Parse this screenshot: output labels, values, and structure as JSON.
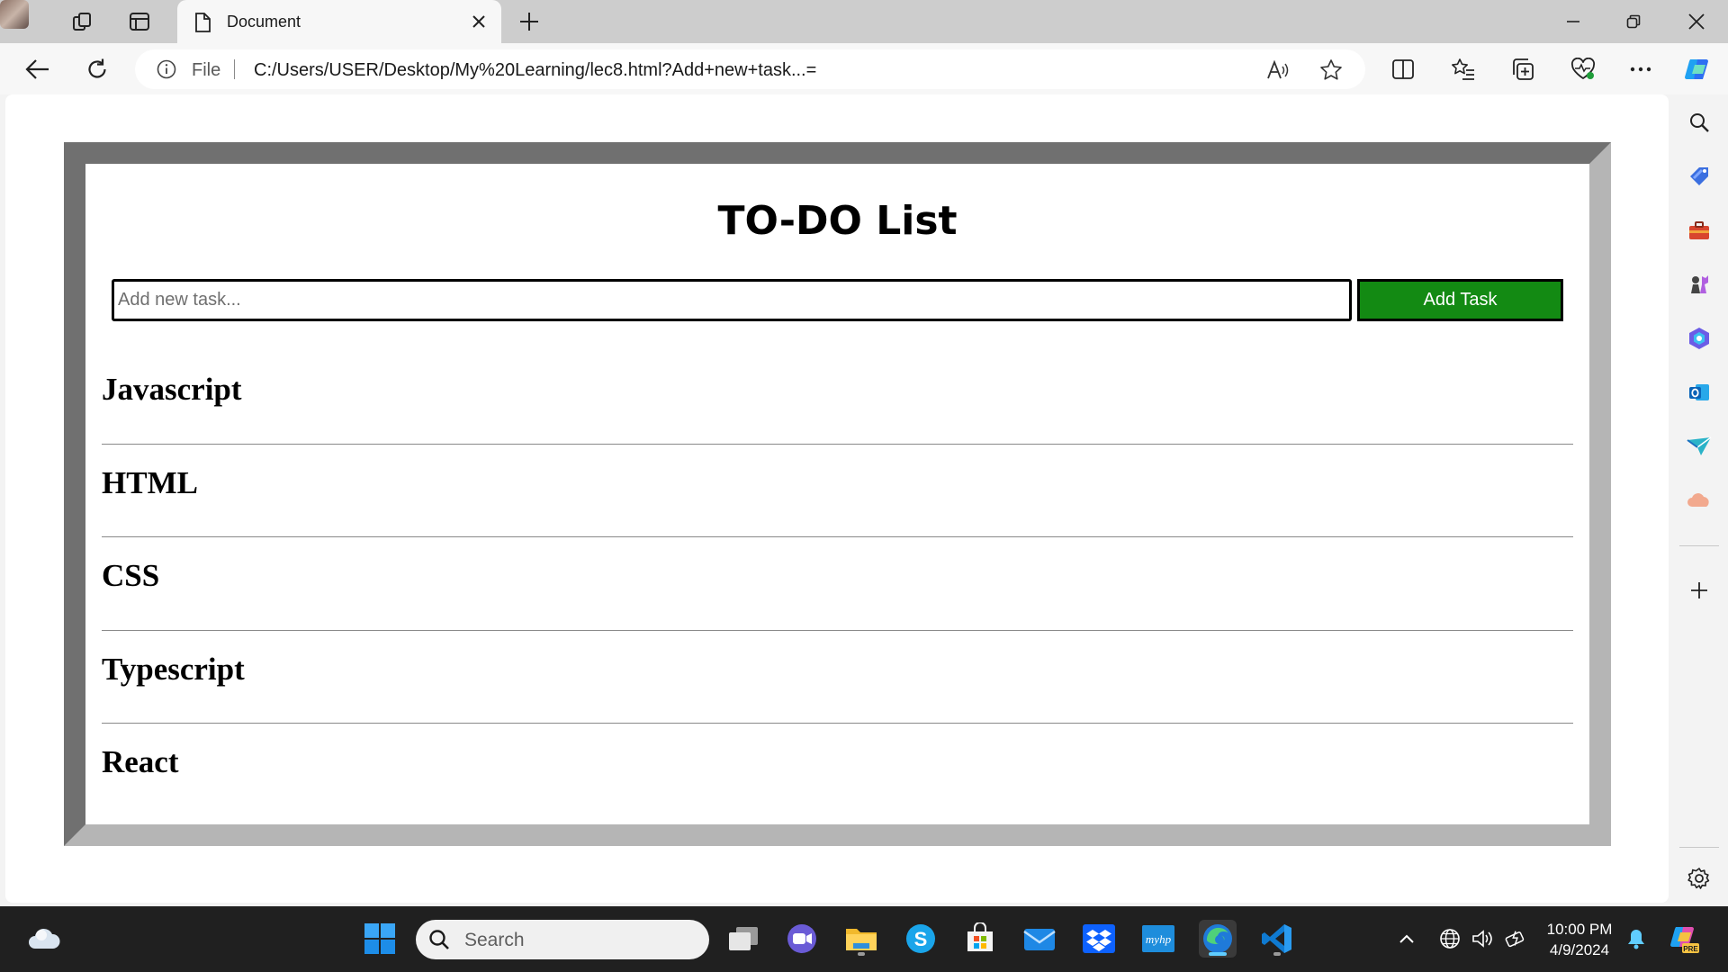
{
  "browser": {
    "tab": {
      "title": "Document",
      "icon": "document-icon"
    },
    "address_bar": {
      "scheme_label": "File",
      "url": "C:/Users/USER/Desktop/My%20Learning/lec8.html?Add+new+task...="
    }
  },
  "page": {
    "title": "TO-DO List",
    "input": {
      "placeholder": "Add new task...",
      "value": ""
    },
    "add_button_label": "Add Task",
    "tasks": [
      "Javascript",
      "HTML",
      "CSS",
      "Typescript",
      "React"
    ],
    "colors": {
      "add_button": "#138a13",
      "frame_dark": "#707070",
      "frame_light": "#b5b5b5"
    }
  },
  "edge_sidebar": {
    "items": [
      "search-icon",
      "tag-icon",
      "toolbox-icon",
      "chess-icon",
      "copilot-hex-icon",
      "outlook-icon",
      "send-icon",
      "cloud-icon",
      "add-icon",
      "settings-icon"
    ]
  },
  "taskbar": {
    "search_placeholder": "Search",
    "apps": [
      "widgets-icon",
      "start-icon",
      "task-view-icon",
      "teams-icon",
      "file-explorer-icon",
      "skype-icon",
      "store-icon",
      "mail-icon",
      "dropbox-icon",
      "myhp-icon",
      "edge-icon",
      "vscode-icon"
    ],
    "clock": {
      "time": "10:00 PM",
      "date": "4/9/2024"
    },
    "tray": [
      "chevron-up-icon",
      "language-icon",
      "volume-icon",
      "battery-icon",
      "bell-icon",
      "copilot-pre-icon"
    ]
  }
}
